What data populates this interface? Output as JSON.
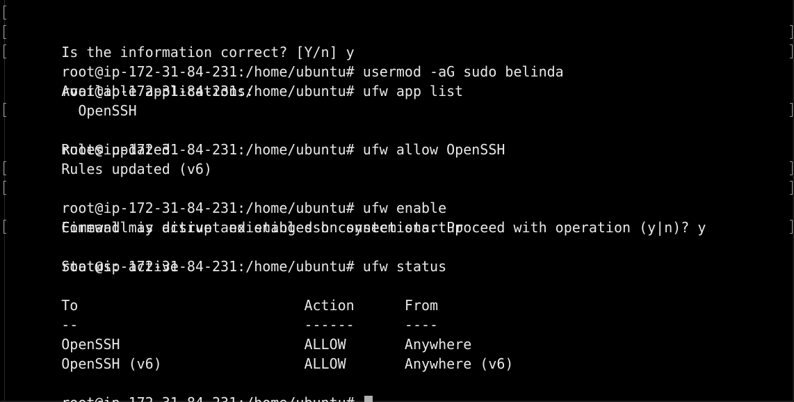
{
  "terminal": {
    "lines": [
      "Is the information correct? [Y/n] y",
      "root@ip-172-31-84-231:/home/ubuntu# usermod -aG sudo belinda",
      "root@ip-172-31-84-231:/home/ubuntu# ufw app list",
      "Available applications:",
      "  OpenSSH",
      "root@ip-172-31-84-231:/home/ubuntu# ufw allow OpenSSH",
      "Rules updated",
      "Rules updated (v6)",
      "root@ip-172-31-84-231:/home/ubuntu# ufw enable",
      "Command may disrupt existing ssh connections. Proceed with operation (y|n)? y",
      "Firewall is active and enabled on system startup",
      "root@ip-172-31-84-231:/home/ubuntu# ufw status",
      "Status: active",
      "",
      "To                           Action      From",
      "--                           ------      ----",
      "OpenSSH                      ALLOW       Anywhere",
      "OpenSSH (v6)                 ALLOW       Anywhere (v6)",
      "",
      "root@ip-172-31-84-231:/home/ubuntu# "
    ]
  },
  "colors": {
    "background": "#000000",
    "text": "#e8e8e8",
    "cursor": "#b0b0b0"
  }
}
